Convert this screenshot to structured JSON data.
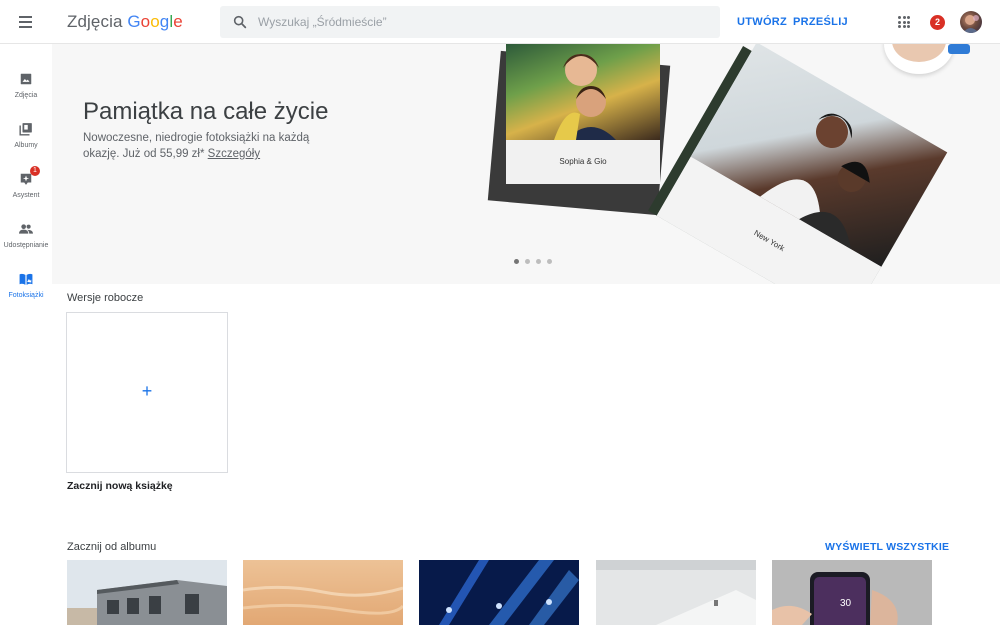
{
  "header": {
    "logo_prefix": "Zdjęcia",
    "logo_brand_letters": [
      {
        "ch": "G",
        "color": "#4285F4"
      },
      {
        "ch": "o",
        "color": "#EA4335"
      },
      {
        "ch": "o",
        "color": "#FBBC05"
      },
      {
        "ch": "g",
        "color": "#4285F4"
      },
      {
        "ch": "l",
        "color": "#34A853"
      },
      {
        "ch": "e",
        "color": "#EA4335"
      }
    ],
    "search_placeholder": "Wyszukaj „Śródmieście”",
    "create_label": "UTWÓRZ",
    "upload_label": "PRZEŚLIJ",
    "notification_count": "2"
  },
  "sidebar": {
    "items": [
      {
        "label": "Zdjęcia",
        "icon": "photo-icon"
      },
      {
        "label": "Albumy",
        "icon": "albums-icon"
      },
      {
        "label": "Asystent",
        "icon": "assistant-icon",
        "badge": "1"
      },
      {
        "label": "Udostępnianie",
        "icon": "sharing-icon"
      },
      {
        "label": "Fotoksiążki",
        "icon": "photobook-icon",
        "active": true
      }
    ]
  },
  "banner": {
    "title": "Pamiątka na całe życie",
    "description": "Nowoczesne, niedrogie fotoksiążki na każdą okazję. Już od 55,99 zł*",
    "details_link": "Szczegóły",
    "book1_caption": "Sophia & Gio",
    "book2_caption": "New York",
    "carousel_active": 0,
    "carousel_count": 4
  },
  "drafts": {
    "title": "Wersje robocze",
    "new_book_label": "Zacznij nową książkę"
  },
  "albums": {
    "title": "Zacznij od albumu",
    "view_all_label": "WYŚWIETL WSZYSTKIE",
    "phone_time": "30"
  },
  "colors": {
    "accent": "#1a73e8",
    "badge": "#d93025"
  }
}
